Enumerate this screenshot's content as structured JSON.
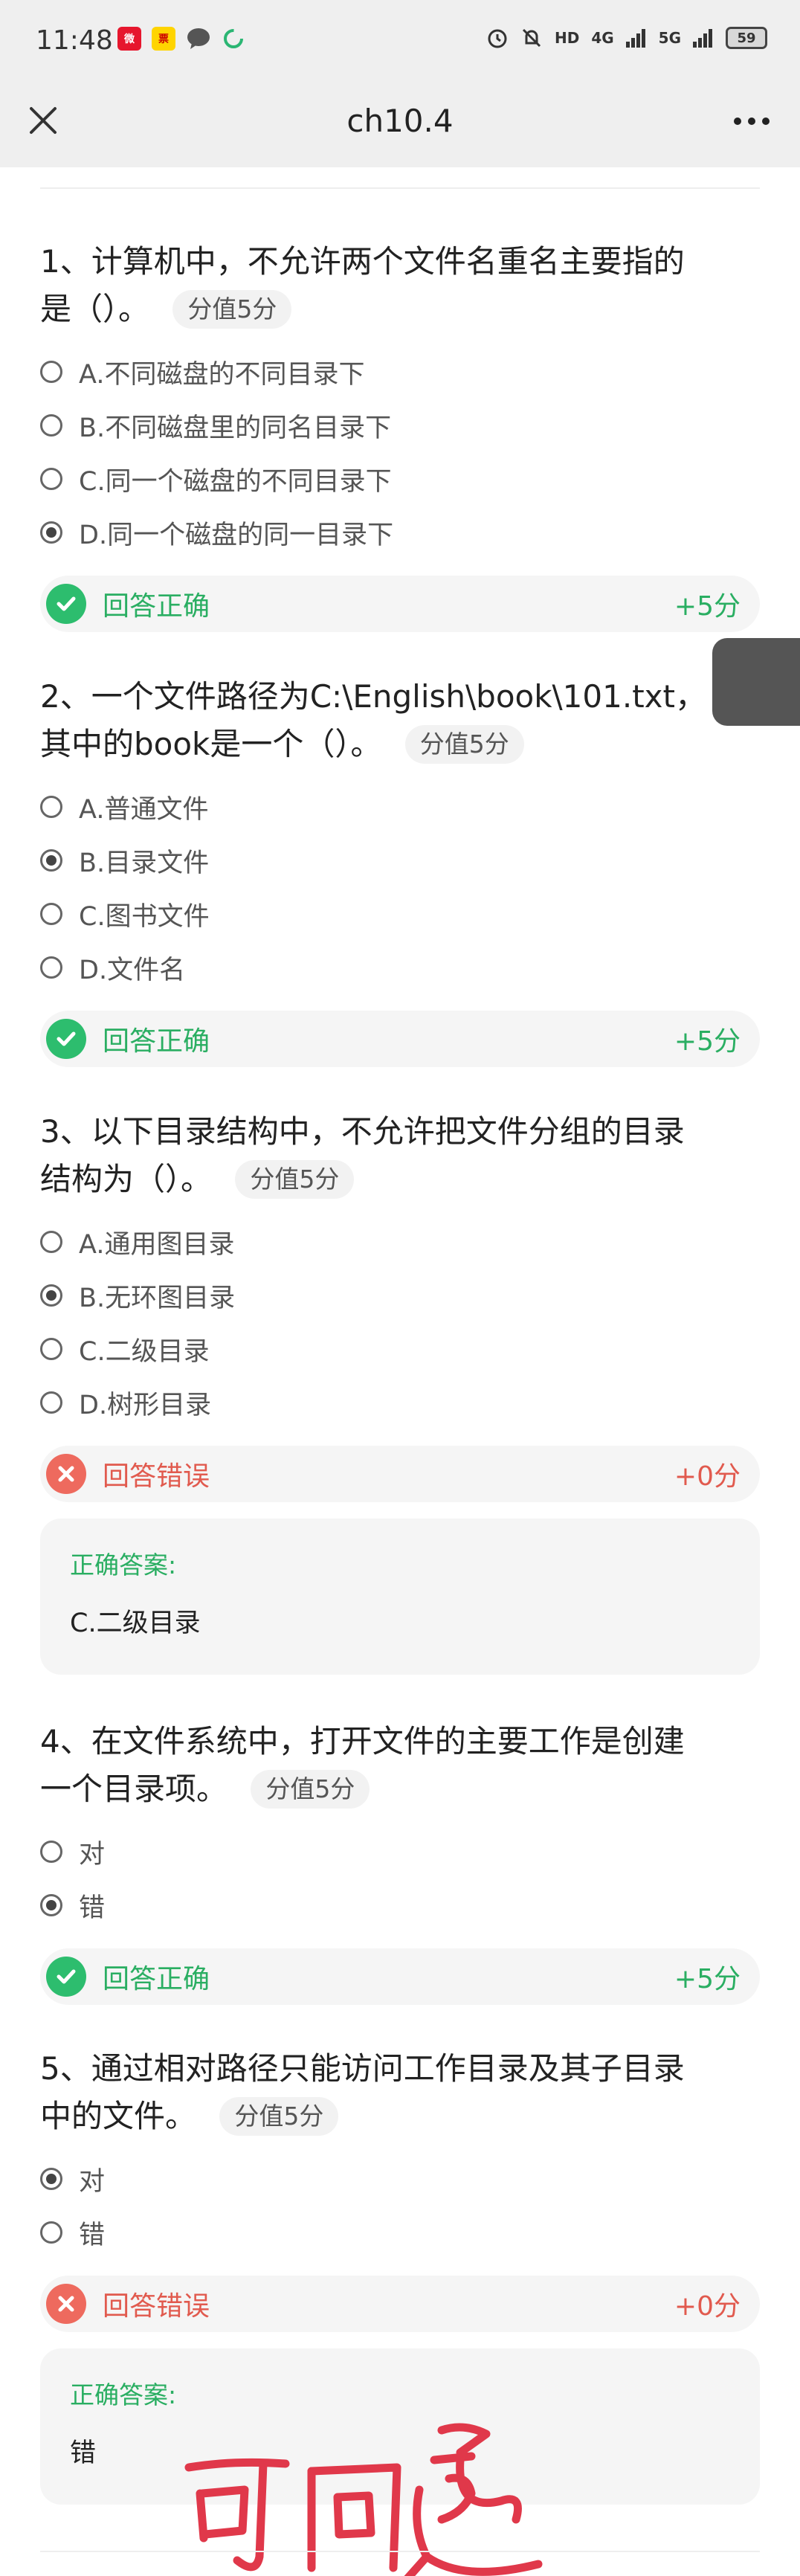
{
  "status_bar": {
    "time": "11:48",
    "app_icons": [
      "weibo-icon",
      "ticket-icon",
      "chat-icon",
      "sync-icon"
    ],
    "indicators": [
      "alarm-icon",
      "mute-icon",
      "HD",
      "4G",
      "5G"
    ],
    "battery": "59"
  },
  "nav": {
    "title": "ch10.4",
    "close_icon": "close-icon",
    "more_icon": "more-icon"
  },
  "colors": {
    "correct": "#2aae62",
    "wrong": "#e15a4e",
    "chip_bg": "#f2f2f2"
  },
  "questions": [
    {
      "title": "1、计算机中，不允许两个文件名重名主要指的是（）。",
      "title_lines": [
        "1、计算机中，不允许两个文件名重名主要指的",
        "是（）。"
      ],
      "score_label": "分值5分",
      "options": [
        {
          "label": "A.不同磁盘的不同目录下",
          "selected": false
        },
        {
          "label": "B.不同磁盘里的同名目录下",
          "selected": false
        },
        {
          "label": "C.同一个磁盘的不同目录下",
          "selected": false
        },
        {
          "label": "D.同一个磁盘的同一目录下",
          "selected": true
        }
      ],
      "result": {
        "status": "correct",
        "text": "回答正确",
        "score": "+5分"
      }
    },
    {
      "title": "2、一个文件路径为C:\\English\\book\\101.txt，其中的book是一个（）。",
      "title_lines": [
        "2、一个文件路径为C:\\English\\book\\101.txt，",
        "其中的book是一个（）。"
      ],
      "score_label": "分值5分",
      "options": [
        {
          "label": "A.普通文件",
          "selected": false
        },
        {
          "label": "B.目录文件",
          "selected": true
        },
        {
          "label": "C.图书文件",
          "selected": false
        },
        {
          "label": "D.文件名",
          "selected": false
        }
      ],
      "result": {
        "status": "correct",
        "text": "回答正确",
        "score": "+5分"
      }
    },
    {
      "title": "3、以下目录结构中，不允许把文件分组的目录结构为（）。",
      "title_lines": [
        "3、以下目录结构中，不允许把文件分组的目录",
        "结构为（）。"
      ],
      "score_label": "分值5分",
      "options": [
        {
          "label": "A.通用图目录",
          "selected": false
        },
        {
          "label": "B.无环图目录",
          "selected": true
        },
        {
          "label": "C.二级目录",
          "selected": false
        },
        {
          "label": "D.树形目录",
          "selected": false
        }
      ],
      "result": {
        "status": "wrong",
        "text": "回答错误",
        "score": "+0分"
      },
      "correct_answer": {
        "label": "正确答案:",
        "value": "C.二级目录"
      }
    },
    {
      "title": "4、在文件系统中，打开文件的主要工作是创建一个目录项。",
      "title_lines": [
        "4、在文件系统中，打开文件的主要工作是创建",
        "一个目录项。"
      ],
      "score_label": "分值5分",
      "options": [
        {
          "label": "对",
          "selected": false
        },
        {
          "label": "错",
          "selected": true
        }
      ],
      "result": {
        "status": "correct",
        "text": "回答正确",
        "score": "+5分"
      }
    },
    {
      "title": "5、通过相对路径只能访问工作目录及其子目录中的文件。",
      "title_lines": [
        "5、通过相对路径只能访问工作目录及其子目录",
        "中的文件。"
      ],
      "score_label": "分值5分",
      "options": [
        {
          "label": "对",
          "selected": true
        },
        {
          "label": "错",
          "selected": false
        }
      ],
      "result": {
        "status": "wrong",
        "text": "回答错误",
        "score": "+0分"
      },
      "correct_answer": {
        "label": "正确答案:",
        "value": "错"
      },
      "handwritten_note": "可回退"
    }
  ]
}
